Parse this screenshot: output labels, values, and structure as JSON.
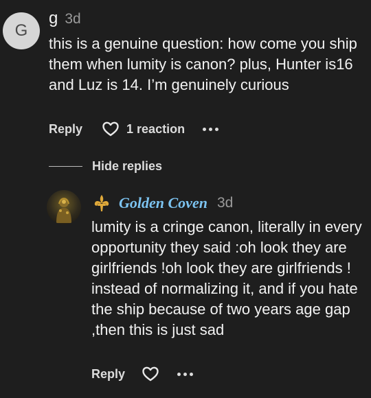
{
  "comment": {
    "avatar_letter": "G",
    "username": "g",
    "time": "3d",
    "body": "this is a genuine question: how come you ship them when lumity is canon? plus, Hunter is16 and Luz is 14. I’m genuinely curious",
    "reply_label": "Reply",
    "reaction_count": "1 reaction",
    "heart_icon": "heart-outline-icon",
    "more_icon": "more-dots-icon"
  },
  "hide_replies_label": "Hide replies",
  "reply": {
    "username": "Golden Coven",
    "time": "3d",
    "body": "lumity is a cringe canon, literally in every opportunity they said :oh look they are girlfriends !oh look they are girlfriends ! instead of normalizing it, and if you hate the ship because of two years age gap ,then this is just sad",
    "reply_label": "Reply",
    "heart_icon": "heart-outline-icon",
    "more_icon": "more-dots-icon",
    "badge_icon": "fleur-de-lis-icon",
    "badge_color": "#e0a93a"
  },
  "colors": {
    "background": "#1e1e1e",
    "text": "#f2f2f2",
    "muted": "#9a9a9a",
    "username_accent": "#7cc3f0"
  }
}
